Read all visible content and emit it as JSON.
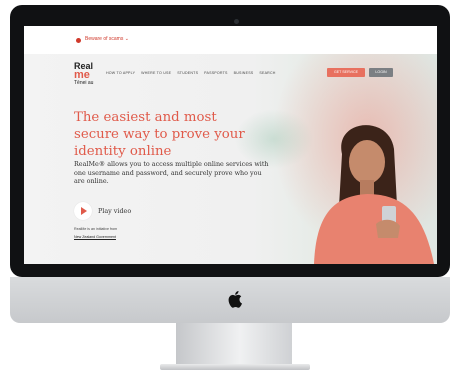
{
  "alert": {
    "text": "Beware of scams ⌄"
  },
  "logo": {
    "line1": "Real",
    "line2": "me",
    "line3": "Tēnei au"
  },
  "nav": {
    "items": [
      "HOW TO APPLY",
      "WHERE TO USE",
      "STUDENTS",
      "PASSPORTS",
      "BUSINESS",
      "SEARCH"
    ],
    "services": "GET SERVICE",
    "login": "LOGIN"
  },
  "hero": {
    "headline": "The easiest and most secure way to prove your identity online",
    "intro": "RealMe® allows you to access multiple online services with one username and password, and securely prove who you are online.",
    "play_label": "Play video",
    "initiative": "RealMe is an initiative from",
    "government": "New Zealand Government"
  },
  "colors": {
    "accent": "#e05a4a",
    "login_bg": "#7b7f83"
  },
  "icons": {
    "apple": "apple-logo-icon",
    "play": "play-icon"
  }
}
